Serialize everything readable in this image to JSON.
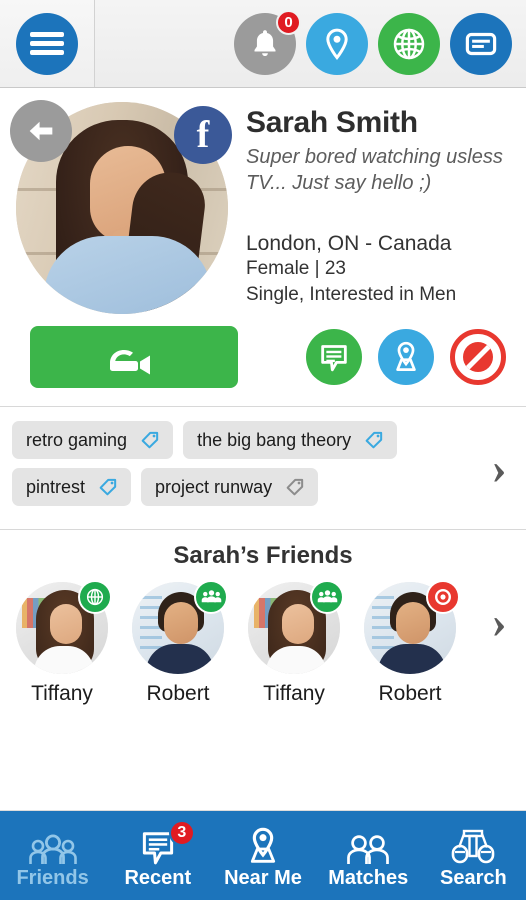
{
  "topbar": {
    "menu_icon": "hamburger-menu-icon",
    "actions": [
      {
        "name": "notifications",
        "icon": "bell-icon",
        "color": "#9b9b9b",
        "badge": "0"
      },
      {
        "name": "near-me",
        "icon": "map-pin-icon",
        "color": "#3aa9e0",
        "badge": null
      },
      {
        "name": "global",
        "icon": "globe-icon",
        "color": "#3cb54a",
        "badge": null
      },
      {
        "name": "messages",
        "icon": "message-card-icon",
        "color": "#1c74bb",
        "badge": null
      }
    ]
  },
  "profile": {
    "back_icon": "back-arrow-icon",
    "facebook_icon": "facebook-icon",
    "facebook_glyph": "f",
    "name": "Sarah Smith",
    "status": "Super bored watching usless TV... Just say hello ;)",
    "location": "London, ON - Canada",
    "gender_age": "Female | 23",
    "relationship": "Single, Interested in Men",
    "photo_alt": "profile-photo"
  },
  "actions": {
    "video_call": {
      "label": "",
      "icon": "video-call-icon",
      "color": "#3cb54a"
    },
    "chat": {
      "icon": "chat-bubble-icon",
      "color": "#3cb54a"
    },
    "map": {
      "icon": "map-location-icon",
      "color": "#3aa9e0"
    },
    "block": {
      "icon": "block-icon",
      "color": "#e8382f"
    }
  },
  "tags": {
    "rows": [
      [
        {
          "label": "retro gaming",
          "icon": "tag-icon",
          "color": "#3aa9e0"
        },
        {
          "label": "the big bang theory",
          "icon": "tag-icon",
          "color": "#3aa9e0"
        }
      ],
      [
        {
          "label": "pintrest",
          "icon": "tag-icon",
          "color": "#3aa9e0"
        },
        {
          "label": "project runway",
          "icon": "tag-icon",
          "color": "#8c8c8c"
        }
      ]
    ],
    "more_icon": "chevron-right-icon",
    "more_glyph": "›"
  },
  "friends": {
    "title": "Sarah’s Friends",
    "more_icon": "chevron-right-icon",
    "more_glyph": "›",
    "items": [
      {
        "name": "Tiffany",
        "badge_icon": "globe-icon",
        "badge_color": "#1fab4e",
        "avatar": "female"
      },
      {
        "name": "Robert",
        "badge_icon": "group-icon",
        "badge_color": "#1fab4e",
        "avatar": "male"
      },
      {
        "name": "Tiffany",
        "badge_icon": "group-icon",
        "badge_color": "#1fab4e",
        "avatar": "female"
      },
      {
        "name": "Robert",
        "badge_icon": "target-icon",
        "badge_color": "#e8382f",
        "avatar": "male"
      }
    ]
  },
  "bottomnav": {
    "background": "#1c74bb",
    "items": [
      {
        "label": "Friends",
        "icon": "group-icon",
        "active": true,
        "badge": null
      },
      {
        "label": "Recent",
        "icon": "chat-bubble-icon",
        "active": false,
        "badge": "3"
      },
      {
        "label": "Near Me",
        "icon": "map-location-icon",
        "active": false,
        "badge": null
      },
      {
        "label": "Matches",
        "icon": "two-people-icon",
        "active": false,
        "badge": null
      },
      {
        "label": "Search",
        "icon": "binoculars-icon",
        "active": false,
        "badge": null
      }
    ]
  }
}
